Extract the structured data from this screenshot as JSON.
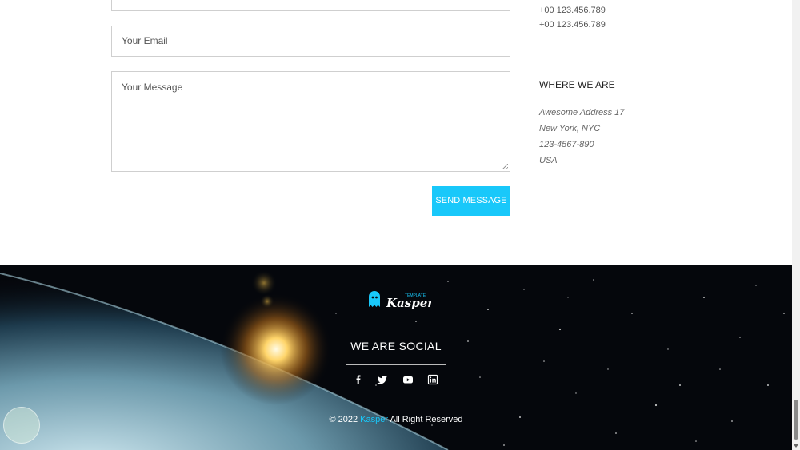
{
  "contact_form": {
    "email_placeholder": "Your Email",
    "message_placeholder": "Your Message",
    "send_label": "SEND MESSAGE"
  },
  "contact_info": {
    "phones": [
      "+00 123.456.789",
      "+00 123.456.789"
    ],
    "where_title": "WHERE WE ARE",
    "address_lines": [
      "Awesome Address 17",
      "New York, NYC",
      "123-4567-890",
      "USA"
    ]
  },
  "footer": {
    "logo_text": "Kasper",
    "logo_tag": "TEMPLATE",
    "social_title": "WE ARE SOCIAL",
    "social_icons": [
      "facebook-icon",
      "twitter-icon",
      "youtube-icon",
      "linkedin-icon"
    ],
    "copyright_prefix": "© 2022 ",
    "copyright_brand": "Kasper",
    "copyright_suffix": " All Right Reserved"
  },
  "colors": {
    "accent": "#19c8fa",
    "footer_bg": "#05070c"
  }
}
